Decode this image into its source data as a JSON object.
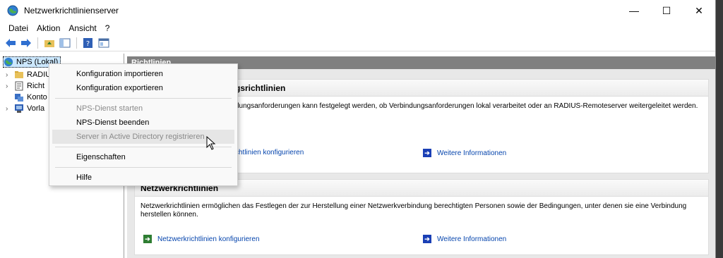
{
  "window": {
    "title": "Netzwerkrichtlinienserver",
    "controls": {
      "minimize": "—",
      "maximize": "☐",
      "close": "✕"
    }
  },
  "menubar": {
    "items": [
      "Datei",
      "Aktion",
      "Ansicht",
      "?"
    ]
  },
  "toolbar": {
    "icons": [
      "back-arrow-icon",
      "forward-arrow-icon",
      "folder-up-icon",
      "show-hide-tree-icon",
      "help-icon",
      "console-icon"
    ]
  },
  "tree": {
    "root": "NPS (Lokal)",
    "children": [
      "RADIUS",
      "Richt",
      "Konto",
      "Vorla"
    ]
  },
  "main": {
    "header": "Richtlinien",
    "panel1": {
      "title_visible": "gsrichtlinien",
      "text_visible": "dungsanforderungen kann festgelegt werden, ob Verbindungsanforderungen lokal verarbeitet oder an RADIUS-Remoteserver weitergeleitet werden.",
      "link_configure_visible": "chtlinien konfigurieren",
      "link_more": "Weitere Informationen"
    },
    "panel2": {
      "title": "Netzwerkrichtlinien",
      "text": "Netzwerkrichtlinien ermöglichen das Festlegen der zur Herstellung einer Netzwerkverbindung berechtigten Personen sowie der Bedingungen, unter denen sie eine Verbindung herstellen können.",
      "link_configure": "Netzwerkrichtlinien konfigurieren",
      "link_more": "Weitere Informationen"
    }
  },
  "context_menu": {
    "items": [
      {
        "label": "Konfiguration importieren",
        "enabled": true
      },
      {
        "label": "Konfiguration exportieren",
        "enabled": true
      },
      {
        "label": "NPS-Dienst starten",
        "enabled": false
      },
      {
        "label": "NPS-Dienst beenden",
        "enabled": true
      },
      {
        "label": "Server in Active Directory registrieren",
        "enabled": false,
        "hover": true
      },
      {
        "label": "Eigenschaften",
        "enabled": true
      },
      {
        "label": "Hilfe",
        "enabled": true
      }
    ]
  },
  "colors": {
    "header_bg": "#808080",
    "link": "#0645ad",
    "link_icon_green": "#2e7d32",
    "link_icon_blue": "#1a3fb5",
    "selection": "#cce8ff"
  }
}
